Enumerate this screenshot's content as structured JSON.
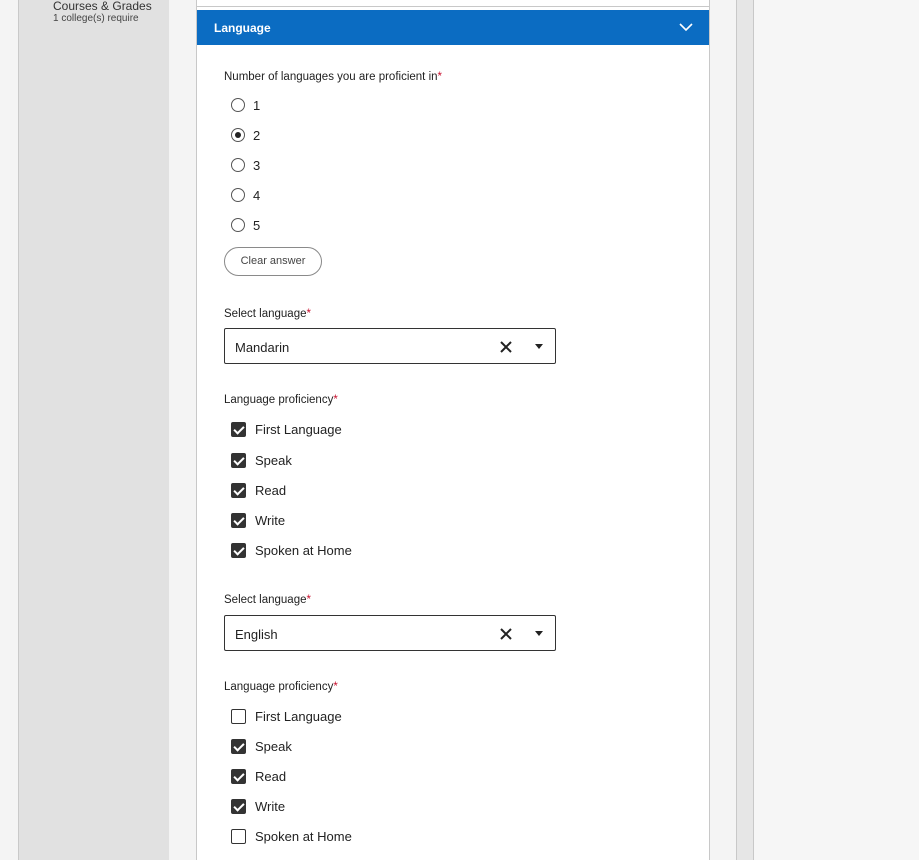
{
  "sidebar": {
    "item_title": "Courses & Grades",
    "item_subtitle": "1 college(s) require"
  },
  "section": {
    "title": "Language"
  },
  "num_languages": {
    "label": "Number of languages you are proficient in",
    "required_mark": "*",
    "options": [
      "1",
      "2",
      "3",
      "4",
      "5"
    ],
    "selected": "2",
    "clear_label": "Clear answer"
  },
  "languages": [
    {
      "select_label": "Select language",
      "required_mark": "*",
      "value": "Mandarin",
      "proficiency_label": "Language proficiency",
      "proficiency": [
        {
          "label": "First Language",
          "checked": true
        },
        {
          "label": "Speak",
          "checked": true
        },
        {
          "label": "Read",
          "checked": true
        },
        {
          "label": "Write",
          "checked": true
        },
        {
          "label": "Spoken at Home",
          "checked": true
        }
      ]
    },
    {
      "select_label": "Select language",
      "required_mark": "*",
      "value": "English",
      "proficiency_label": "Language proficiency",
      "proficiency": [
        {
          "label": "First Language",
          "checked": false
        },
        {
          "label": "Speak",
          "checked": true
        },
        {
          "label": "Read",
          "checked": true
        },
        {
          "label": "Write",
          "checked": true
        },
        {
          "label": "Spoken at Home",
          "checked": false
        }
      ]
    }
  ],
  "colors": {
    "header_bg": "#0b6cc2",
    "required": "#c8102e",
    "checkbox_fill": "#333333"
  }
}
